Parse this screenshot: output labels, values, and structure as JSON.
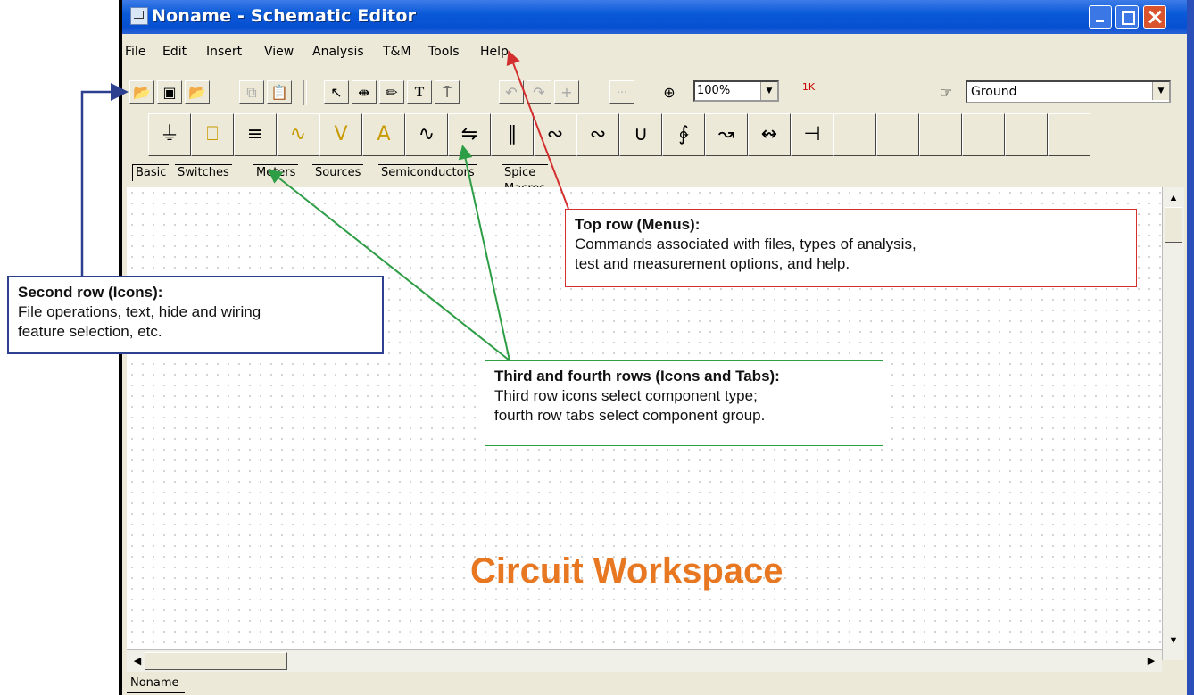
{
  "window": {
    "title": "Noname - Schematic Editor"
  },
  "menubar": [
    "File",
    "Edit",
    "Insert",
    "View",
    "Analysis",
    "T&M",
    "Tools",
    "Help"
  ],
  "toolbar": {
    "icons": [
      "open-folder-icon",
      "save-icon",
      "open-icon",
      "copy-icon",
      "paste-icon",
      "pointer-icon",
      "wire-icon",
      "pencil-icon",
      "text-icon",
      "hide-icon",
      "undo-icon",
      "redo-icon",
      "junction-icon",
      "grid-icon",
      "zoom-icon",
      "component-value-icon"
    ],
    "zoom_value": "100%",
    "tool_label": "1K",
    "ground_value": "Ground"
  },
  "component_tabs": [
    "Basic",
    "Switches",
    "Meters",
    "Sources",
    "Semiconductors",
    "Spice Macros"
  ],
  "document_tab": "Noname",
  "workspace_label": "Circuit Workspace",
  "callouts": {
    "menus": {
      "heading": "Top row (Menus):",
      "line1": "Commands associated with files, types of analysis,",
      "line2": "test and measurement options, and help."
    },
    "icons": {
      "heading": "Second row (Icons):",
      "line1": "File operations, text, hide and wiring",
      "line2": "feature selection, etc."
    },
    "components": {
      "heading": "Third and fourth rows (Icons and Tabs):",
      "line1": "Third row icons select component type;",
      "line2": "fourth row tabs select component group."
    }
  },
  "colors": {
    "menus_arrow": "#d32f2f",
    "icons_arrow": "#2d3f8f",
    "components_arrow": "#2e9e46",
    "workspace_label": "#e87722"
  }
}
